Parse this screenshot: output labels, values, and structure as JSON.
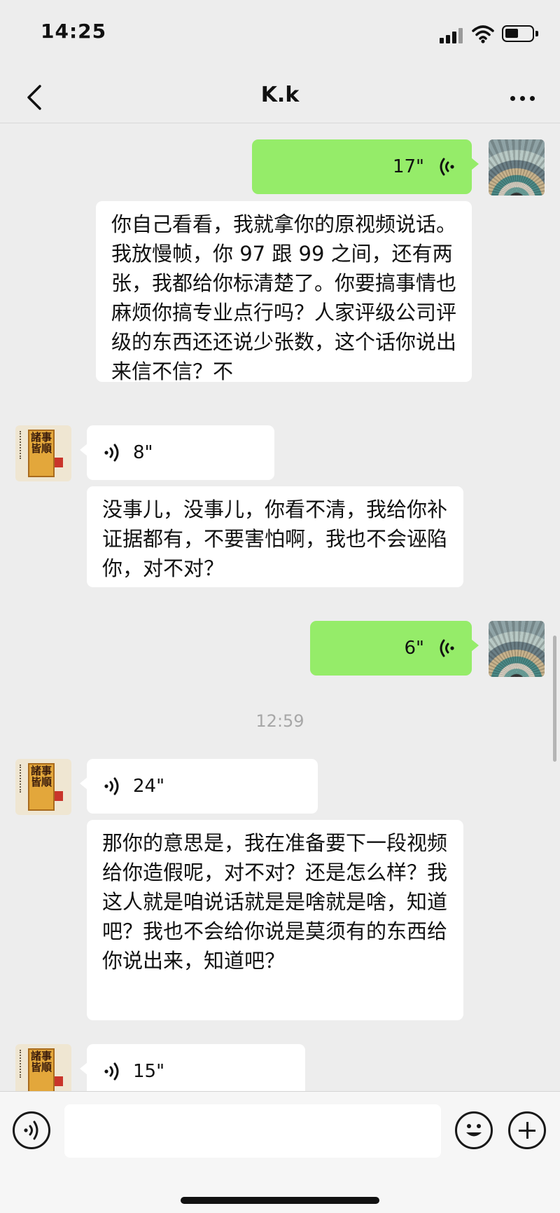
{
  "status_bar": {
    "time": "14:25"
  },
  "header": {
    "title": "K.k",
    "back_icon": "chevron-left-icon",
    "more_icon": "more-dots-icon"
  },
  "messages": [
    {
      "side": "right",
      "type": "voice",
      "duration": "17\""
    },
    {
      "side": "right",
      "type": "transcript",
      "text": "你自己看看，我就拿你的原视频说话。我放慢帧，你 97 跟 99 之间，还有两张，我都给你标清楚了。你要搞事情也麻烦你搞专业点行吗？人家评级公司评级的东西还还说少张数，这个话你说出来信不信？不"
    },
    {
      "side": "left",
      "type": "voice",
      "duration": "8\""
    },
    {
      "side": "left",
      "type": "transcript",
      "text": "没事儿，没事儿，你看不清，我给你补证据都有，不要害怕啊，我也不会诬陷你，对不对？"
    },
    {
      "side": "right",
      "type": "voice",
      "duration": "6\""
    },
    {
      "side": "center",
      "type": "timestamp",
      "text": "12:59"
    },
    {
      "side": "left",
      "type": "voice",
      "duration": "24\""
    },
    {
      "side": "left",
      "type": "transcript",
      "text": "那你的意思是，我在准备要下一段视频给你造假呢，对不对？还是怎么样？我这人就是咱说话就是是啥就是啥，知道吧？我也不会给你说是莫须有的东西给你说出来，知道吧？"
    },
    {
      "side": "left",
      "type": "voice",
      "duration": "15\""
    }
  ],
  "contact_avatar": {
    "text": "諸事皆順"
  },
  "input_bar": {
    "placeholder": "",
    "voice_icon": "voice-mode-icon",
    "emoji_icon": "emoji-icon",
    "plus_icon": "plus-icon"
  },
  "colors": {
    "my_bubble": "#95ec69",
    "their_bubble": "#ffffff",
    "background": "#ededed",
    "timestamp": "#a7a7a7"
  }
}
